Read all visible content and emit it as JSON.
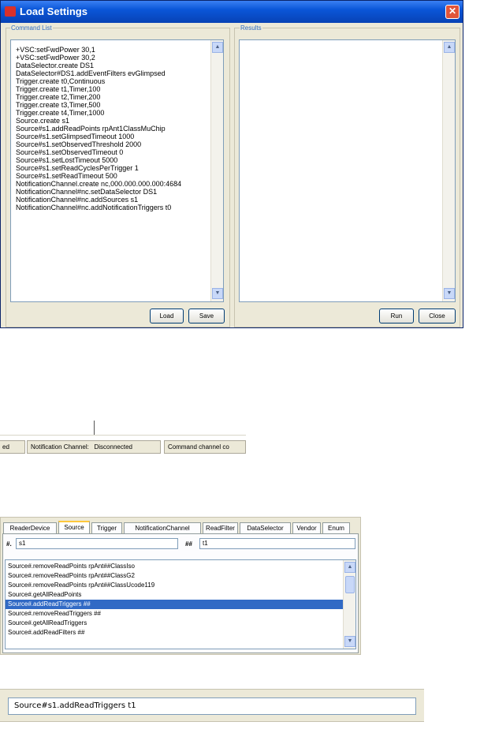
{
  "window": {
    "title": "Load Settings",
    "command_list_label": "Command List",
    "results_label": "Results",
    "commands": [
      "+VSC:setFwdPower 30,1",
      "+VSC:setFwdPower 30,2",
      "DataSelector.create DS1",
      "DataSelector#DS1.addEventFilters evGlimpsed",
      "Trigger.create t0,Continuous",
      "Trigger.create t1,Timer,100",
      "Trigger.create t2,Timer,200",
      "Trigger.create t3,Timer,500",
      "Trigger.create t4,Timer,1000",
      "Source.create s1",
      "Source#s1.addReadPoints rpAnt1ClassMuChip",
      "Source#s1.setGlimpsedTimeout 1000",
      "Source#s1.setObservedThreshold 2000",
      "Source#s1.setObservedTimeout 0",
      "Source#s1.setLostTimeout 5000",
      "Source#s1.setReadCyclesPerTrigger 1",
      "Source#s1.setReadTimeout 500",
      "NotificationChannel.create nc,000.000.000.000:4684",
      "NotificationChannel#nc.setDataSelector DS1",
      "NotificationChannel#nc.addSources s1",
      "NotificationChannel#nc.addNotificationTriggers t0"
    ],
    "load_label": "Load",
    "save_label": "Save",
    "run_label": "Run",
    "close_label": "Close"
  },
  "statusbar": {
    "seg1": "ed",
    "seg2": "Notification Channel:",
    "seg2_value": "Disconnected",
    "seg3": "Command channel co"
  },
  "panel": {
    "tabs": [
      "ReaderDevice",
      "Source",
      "Trigger",
      "NotificationChannel",
      "ReadFilter",
      "DataSelector",
      "Vendor",
      "Enum"
    ],
    "active_tab": "Source",
    "field1_label": "#.",
    "field1_value": "s1",
    "field2_label": "##",
    "field2_value": "t1",
    "items": [
      "Source#.removeReadPoints rpAnt##ClassIso",
      "Source#.removeReadPoints rpAnt##ClassG2",
      "Source#.removeReadPoints rpAnt##ClassUcode119",
      "Source#.getAllReadPoints",
      "Source#.addReadTriggers ##",
      "Source#.removeReadTriggers ##",
      "Source#.getAllReadTriggers",
      "Source#.addReadFilters ##"
    ],
    "selected_index": 4
  },
  "command_input": {
    "value": "Source#s1.addReadTriggers t1"
  },
  "colors": {
    "title_bar": "#0a56d8",
    "selection": "#316ac5",
    "group_label": "#2f6cc0"
  }
}
